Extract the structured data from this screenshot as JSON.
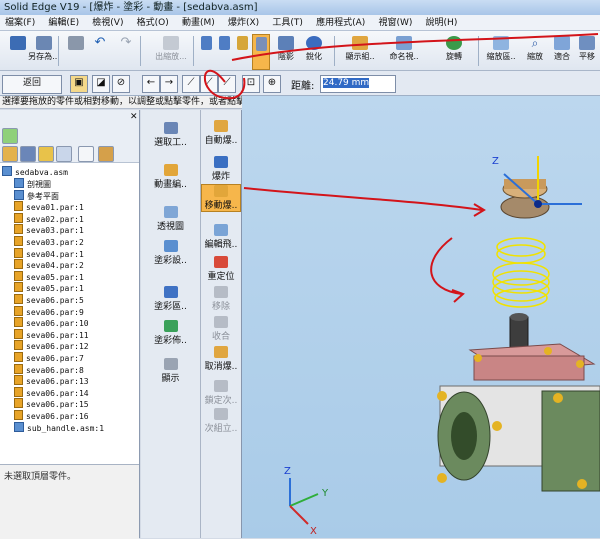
{
  "window": {
    "title": "Solid Edge V19 - [爆炸 - 塗彩 - 動畫 - [sedabva.asm]"
  },
  "menu": [
    "檔案(F)",
    "編輯(E)",
    "檢視(V)",
    "格式(O)",
    "動畫(M)",
    "爆炸(X)",
    "工具(T)",
    "應用程式(A)",
    "視窗(W)",
    "說明(H)"
  ],
  "toolbar": {
    "save_label": "另存為...",
    "clip_label": "出縮放...",
    "render_label": "陰影",
    "sharpen_label": "銳化",
    "display_label": "顯示組..",
    "name_label": "命名視..",
    "rotate_label": "旋轉",
    "zoom_area_label": "縮放區..",
    "zoom_label": "縮放",
    "fit_label": "適合",
    "pan_label": "平移"
  },
  "commandbar": {
    "return_label": "返回",
    "distance_label": "距離:",
    "distance_value": "24.79 mm"
  },
  "status": {
    "prompt": "選擇要拖放的零件或相對移動，以調整或點擊零件，或者點擊一個新的軸。"
  },
  "tree": {
    "root": "sedabva.asm",
    "items": [
      {
        "label": "剖視圖",
        "type": "folder"
      },
      {
        "label": "參考平面",
        "type": "folder"
      },
      {
        "label": "seva01.par:1",
        "type": "part"
      },
      {
        "label": "seva02.par:1",
        "type": "part"
      },
      {
        "label": "seva03.par:1",
        "type": "part"
      },
      {
        "label": "seva03.par:2",
        "type": "part"
      },
      {
        "label": "seva04.par:1",
        "type": "part"
      },
      {
        "label": "seva04.par:2",
        "type": "part"
      },
      {
        "label": "seva05.par:1",
        "type": "part"
      },
      {
        "label": "seva05.par:1",
        "type": "part"
      },
      {
        "label": "seva06.par:5",
        "type": "part"
      },
      {
        "label": "seva06.par:9",
        "type": "part"
      },
      {
        "label": "seva06.par:10",
        "type": "part"
      },
      {
        "label": "seva06.par:11",
        "type": "part"
      },
      {
        "label": "seva06.par:12",
        "type": "part"
      },
      {
        "label": "seva06.par:7",
        "type": "part"
      },
      {
        "label": "seva06.par:8",
        "type": "part"
      },
      {
        "label": "seva06.par:13",
        "type": "part"
      },
      {
        "label": "seva06.par:14",
        "type": "part"
      },
      {
        "label": "seva06.par:15",
        "type": "part"
      },
      {
        "label": "seva06.par:16",
        "type": "part"
      },
      {
        "label": "sub_handle.asm:1",
        "type": "assembly"
      }
    ],
    "status_text": "未選取頂層零件。"
  },
  "commands_left": [
    "選取工..",
    "動畫編..",
    "透視圖",
    "塗彩設..",
    "塗彩區..",
    "塗彩佈..",
    "顯示"
  ],
  "commands_right": [
    "自動爆..",
    "爆炸",
    "移動爆..",
    "編輯飛..",
    "重定位",
    "移除",
    "收合",
    "取消爆..",
    "鎖定次..",
    "次組立.."
  ],
  "viewport": {
    "axis_x": "X",
    "axis_y": "Y",
    "axis_z": "Z"
  }
}
